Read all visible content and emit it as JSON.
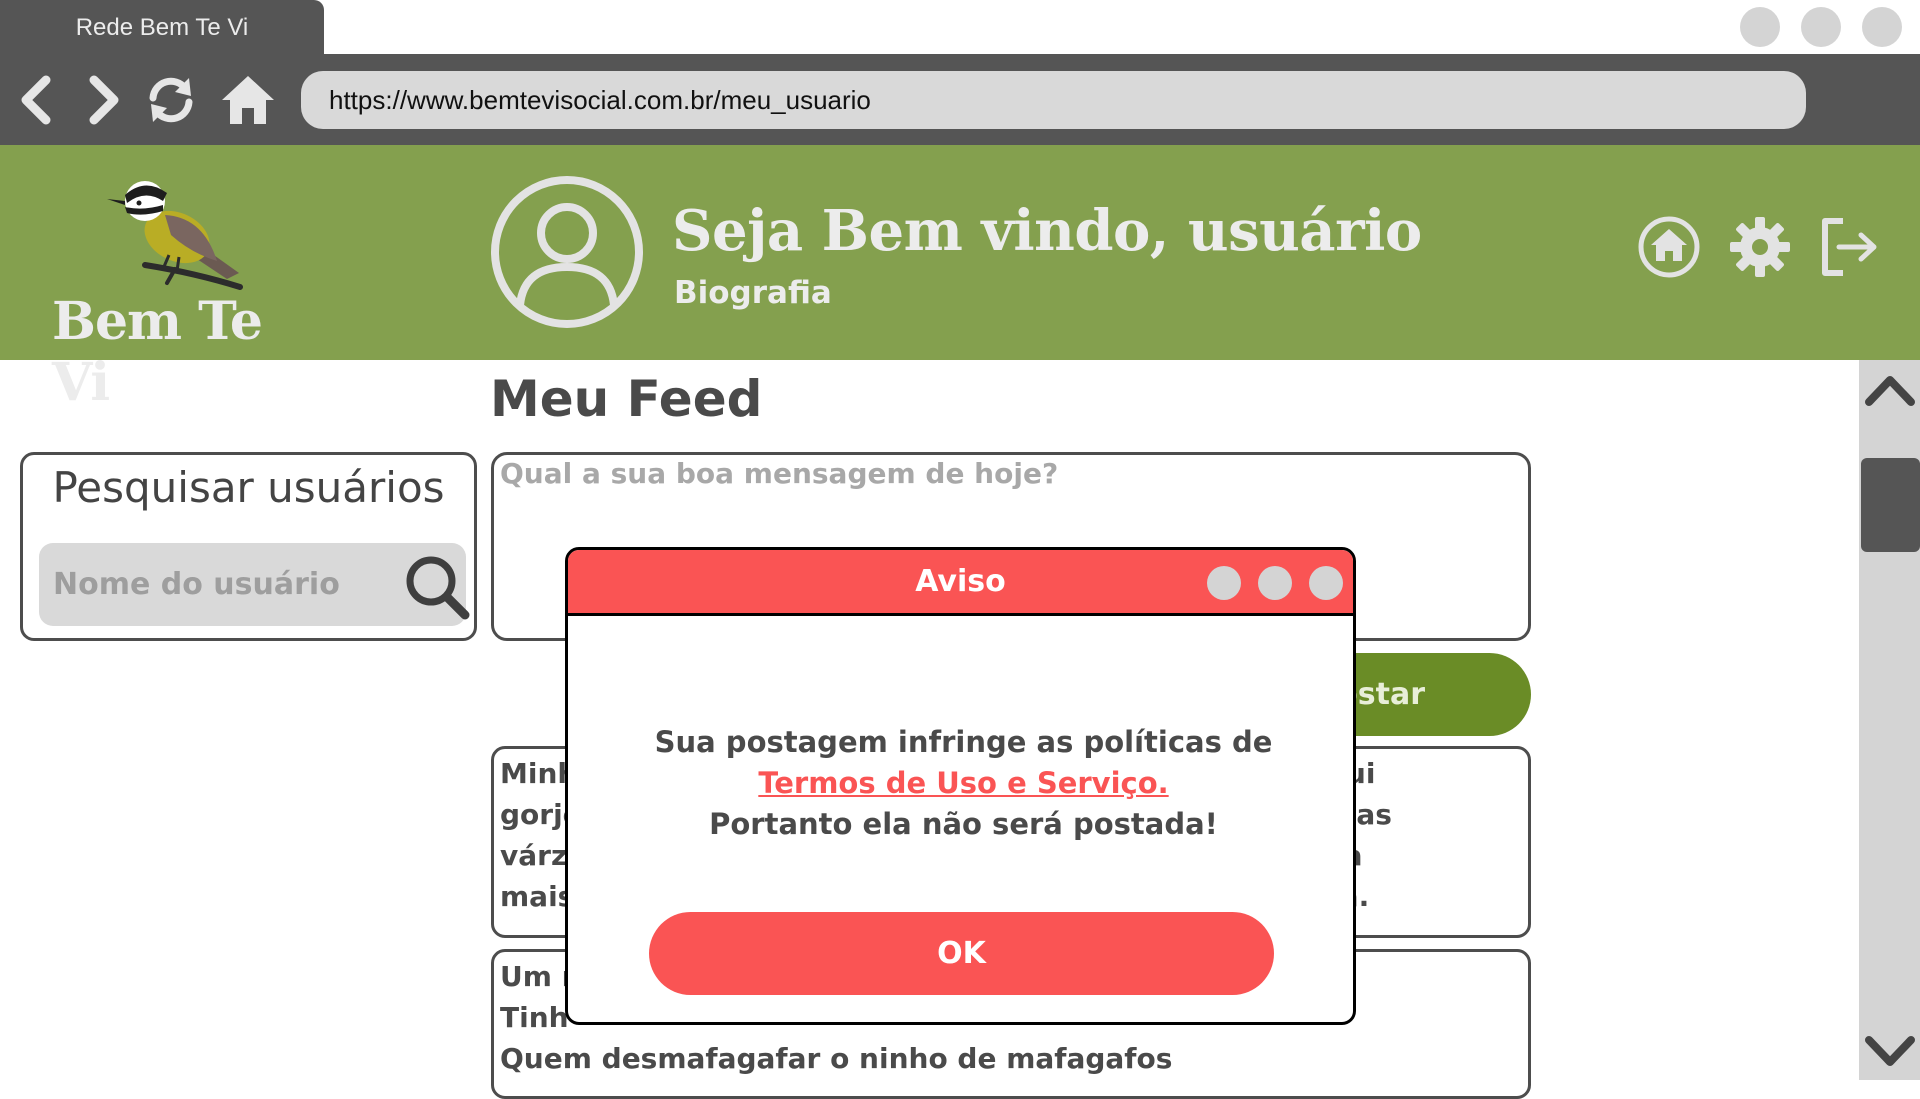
{
  "browser": {
    "tab_title": "Rede Bem Te Vi",
    "url": "https://www.bemtevisocial.com.br/meu_usuario",
    "icons": [
      "back-icon",
      "forward-icon",
      "reload-icon",
      "home-icon"
    ]
  },
  "header": {
    "logo_text": "Bem Te Vi",
    "welcome": "Seja Bem vindo, usuário",
    "bio": "Biografia",
    "icons": [
      "home-icon",
      "gear-icon",
      "logout-icon"
    ],
    "color": "#84a04e"
  },
  "main": {
    "feed_title": "Meu Feed",
    "search": {
      "title": "Pesquisar usuários",
      "placeholder": "Nome do usuário"
    },
    "compose": {
      "placeholder": "Qual a sua boa mensagem de hoje?"
    },
    "post_button": "ostar",
    "posts": [
      {
        "lines": [
          "Minh                                                                s, que aqui",
          "gorje                                                               elas, Nossas",
          "várz                                                                Nossa vida",
          "mais                                                                ncontro lá."
        ]
      },
      {
        "lines": [
          "Um r",
          "Tinh",
          "Quem desmafagafar o ninho de mafagafos"
        ]
      }
    ]
  },
  "modal": {
    "title": "Aviso",
    "message_before_link": "Sua postagem infringe as políticas de ",
    "link_text": "Termos de Uso e Serviço.",
    "message_after": "Portanto ela não será postada!",
    "ok_label": "OK",
    "color": "#fa5454"
  }
}
